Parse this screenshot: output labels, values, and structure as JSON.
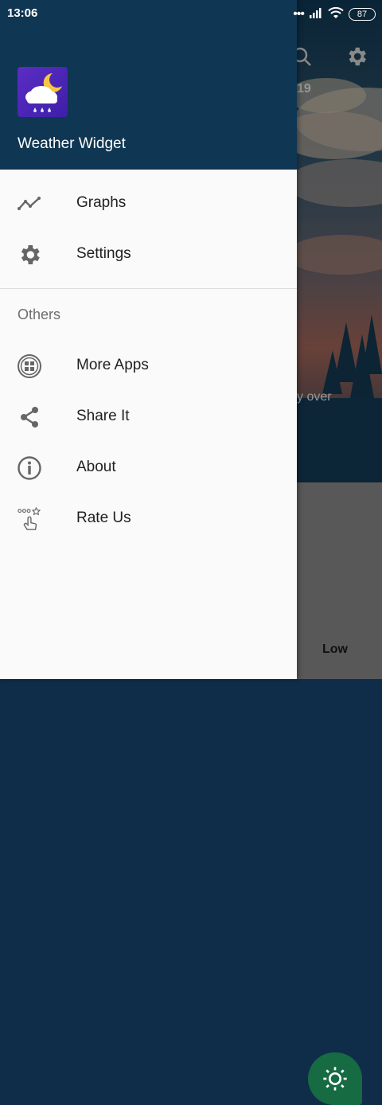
{
  "status_bar": {
    "time": "13:06",
    "battery": "87"
  },
  "background": {
    "date_fragment": "19",
    "text_fragment": "y over",
    "low_label": "Low"
  },
  "drawer": {
    "app_name": "Weather Widget",
    "menu": [
      {
        "label": "Graphs",
        "icon": "chart-line-icon"
      },
      {
        "label": "Settings",
        "icon": "gear-icon"
      }
    ],
    "others_title": "Others",
    "others": [
      {
        "label": "More Apps",
        "icon": "apps-grid-icon"
      },
      {
        "label": "Share It",
        "icon": "share-icon"
      },
      {
        "label": "About",
        "icon": "info-icon"
      },
      {
        "label": "Rate Us",
        "icon": "rate-stars-icon"
      }
    ]
  },
  "colors": {
    "header": "#0f3652",
    "drawer_bg": "#fafafa",
    "fab": "#166b43"
  }
}
